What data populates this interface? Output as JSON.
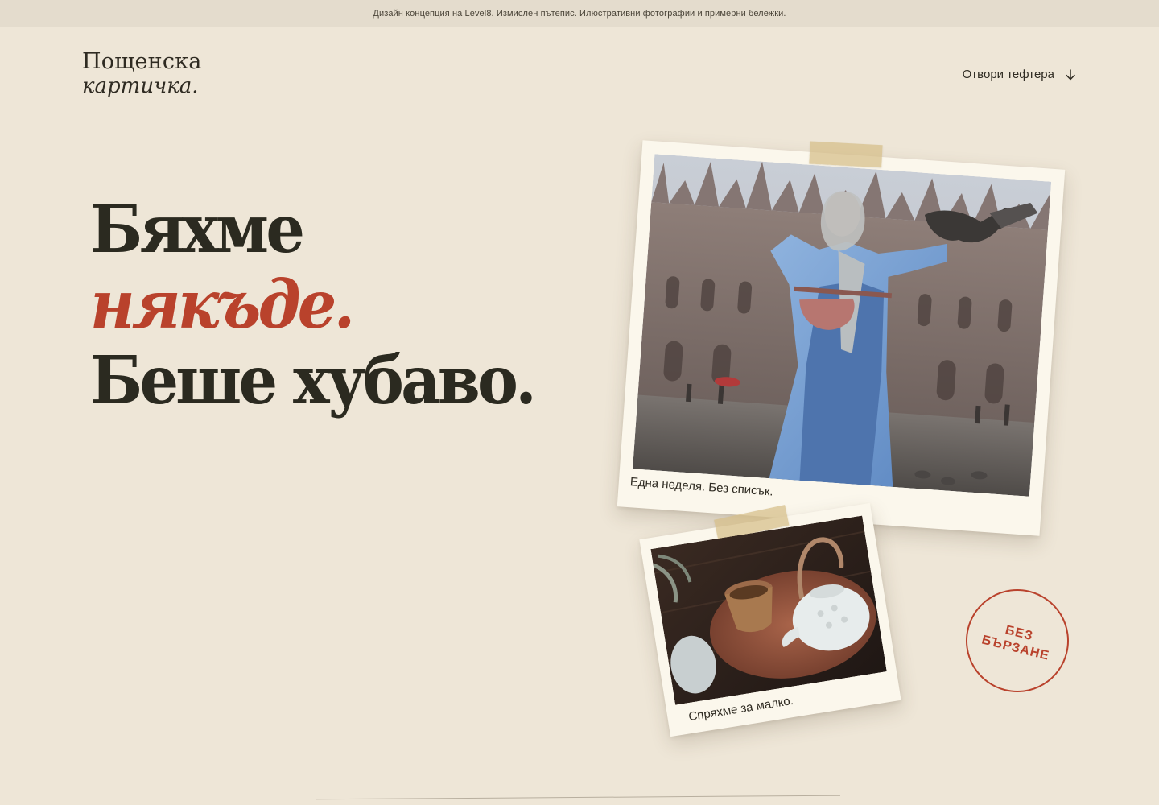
{
  "banner": {
    "text": "Дизайн концепция на Level8. Измислен пътепис. Илюстративни фотографии и примерни бележки."
  },
  "logo": {
    "line1": "Пощенска",
    "line2": "картичка."
  },
  "nav": {
    "cta_label": "Отвори тефтера",
    "cta_icon": "arrow-down-icon"
  },
  "hero": {
    "line1": "Бяхме",
    "line2": "някъде.",
    "line3": "Беше хубаво."
  },
  "postcards": [
    {
      "caption": "Една неделя. Без списък.",
      "subject": "woman-in-blue-coat-with-pigeons-in-front-of-cathedral"
    },
    {
      "caption": "Спряхме за малко.",
      "subject": "tea-cup-and-white-teapot-on-copper-tray"
    }
  ],
  "stamp": {
    "line1": "БЕЗ",
    "line2": "БЪРЗАНЕ"
  },
  "colors": {
    "background": "#eee6d7",
    "banner": "#e4dccd",
    "text": "#2f2b22",
    "accent": "#b9422c",
    "card": "#fbf7ec",
    "tape": "#d6be88"
  }
}
